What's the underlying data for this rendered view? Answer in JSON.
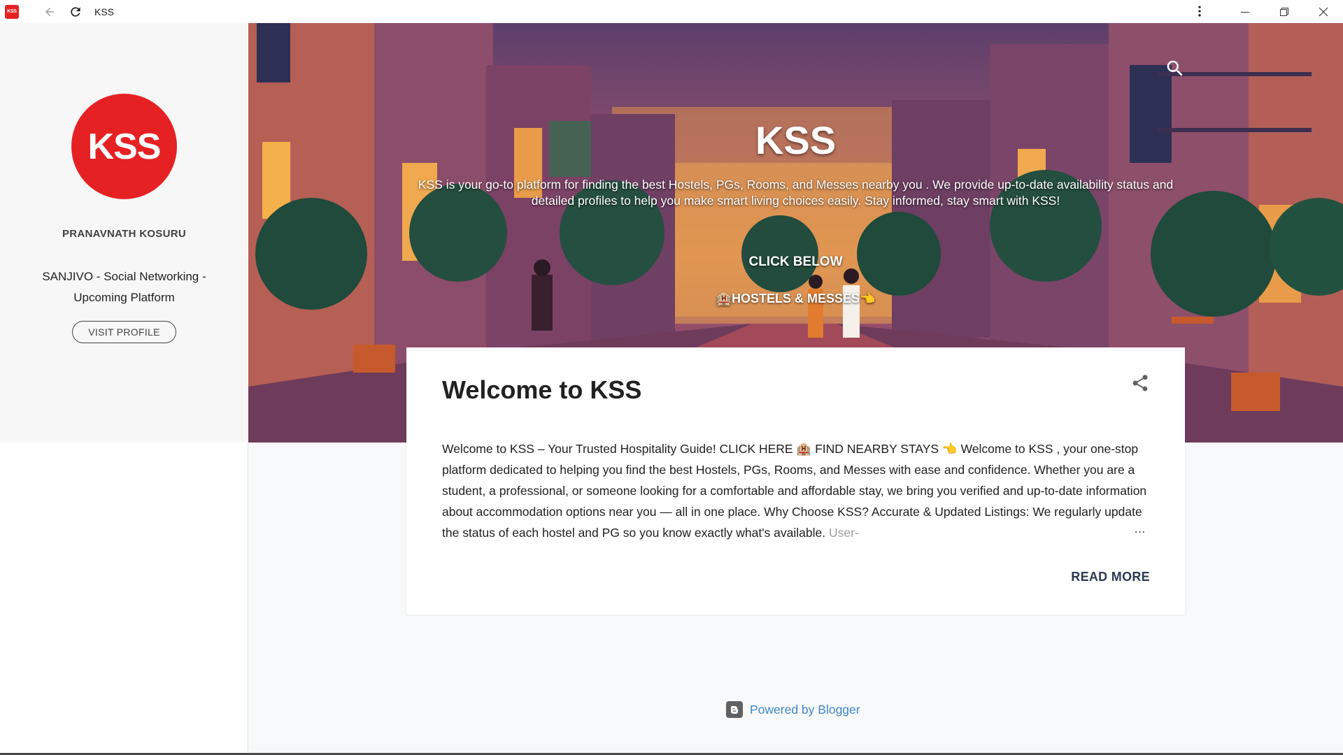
{
  "titlebar": {
    "app_icon_text": "KSS",
    "title": "KSS"
  },
  "sidebar": {
    "avatar_text": "KSS",
    "name": "PRANAVNATH KOSURU",
    "description": "SANJIVO - Social Networking - Upcoming Platform",
    "visit_label": "VISIT PROFILE"
  },
  "hero": {
    "title": "KSS",
    "description": "KSS is your go-to platform for finding the best Hostels, PGs, Rooms, and Messes nearby you . We provide up-to-date availability status and detailed profiles to help you make smart living choices easily. Stay informed, stay smart with KSS!",
    "click_label": "CLICK BELOW",
    "link_label": "🏨HOSTELS & MESSES👈"
  },
  "post": {
    "title": "Welcome to KSS",
    "snippet": "Welcome to KSS – Your Trusted Hospitality Guide! CLICK HERE  🏨 FIND NEARBY STAYS  👈 Welcome to KSS , your one-stop platform dedicated to helping you find the best Hostels, PGs, Rooms, and Messes with ease and confidence. Whether you are a student, a professional, or someone looking for a comfortable and affordable stay, we bring you verified and up-to-date information about accommodation options near you — all in one place. Why Choose KSS? Accurate & Updated Listings: We regularly update the status of each hostel and PG so you know exactly what's available.",
    "snippet_fade": " User-",
    "ellipsis": "…",
    "read_more": "READ MORE"
  },
  "footer": {
    "powered_by": "Powered by Blogger"
  },
  "colors": {
    "brand_red": "#e62123",
    "link_blue": "#3d88c8",
    "read_more": "#2b3a55"
  }
}
